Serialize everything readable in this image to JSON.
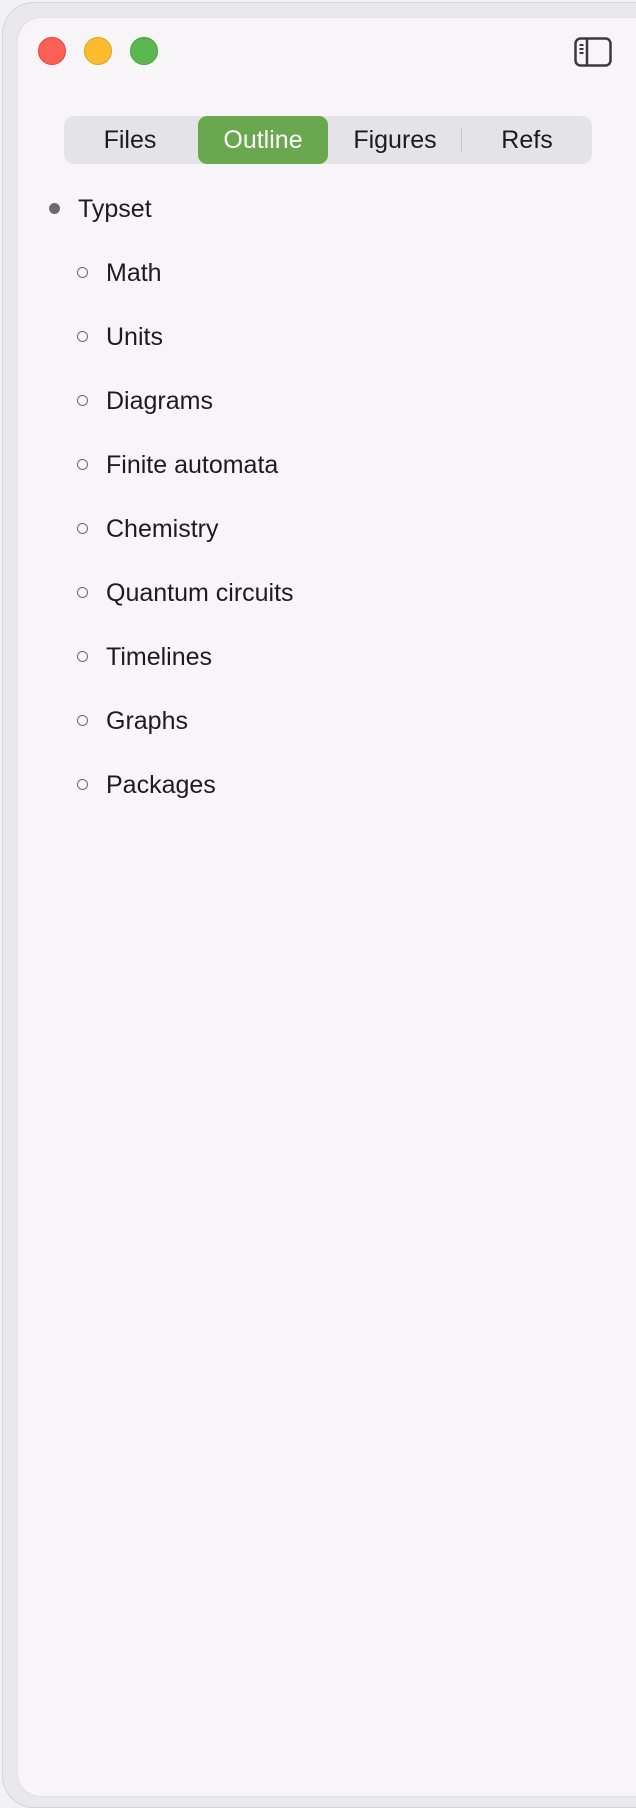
{
  "window": {
    "controls": [
      "close",
      "minimize",
      "maximize"
    ],
    "toolbar_icon": "sidebar-toggle-icon"
  },
  "tabs": [
    {
      "label": "Files",
      "selected": false
    },
    {
      "label": "Outline",
      "selected": true
    },
    {
      "label": "Figures",
      "selected": false
    },
    {
      "label": "Refs",
      "selected": false
    }
  ],
  "outline": {
    "root": {
      "label": "Typset"
    },
    "children": [
      {
        "label": "Math"
      },
      {
        "label": "Units"
      },
      {
        "label": "Diagrams"
      },
      {
        "label": "Finite automata"
      },
      {
        "label": "Chemistry"
      },
      {
        "label": "Quantum circuits"
      },
      {
        "label": "Timelines"
      },
      {
        "label": "Graphs"
      },
      {
        "label": "Packages"
      }
    ]
  },
  "colors": {
    "accent": "#6aa84f",
    "close": "#fe6057",
    "minimize": "#fdbc2e",
    "maximize": "#5bb850"
  }
}
